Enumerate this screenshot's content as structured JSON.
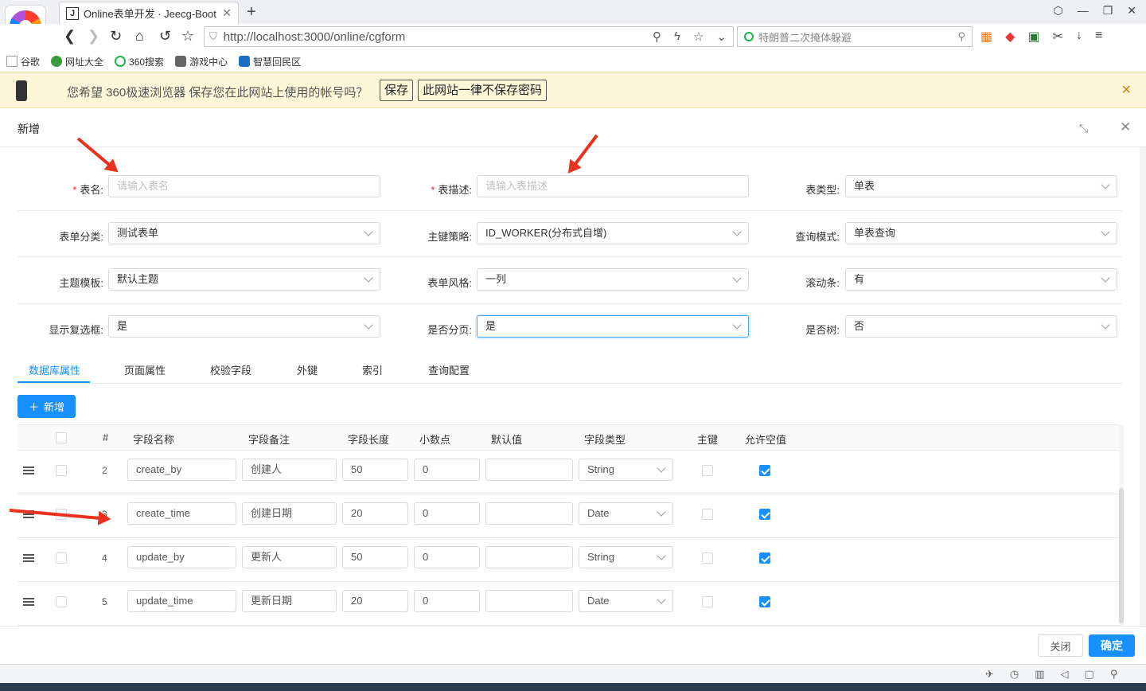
{
  "browser": {
    "tab_title": "Online表单开发 · Jeecg-Boot 企",
    "tab_favicon": "J",
    "url_host": "http://localhost",
    "url_path": ":3000/online/cgform",
    "search_placeholder": "特朗普二次掩体躲避",
    "bookmarks": [
      "谷歌",
      "网址大全",
      "360搜索",
      "游戏中心",
      "智慧回民区"
    ]
  },
  "password_bar": {
    "message": "您希望 360极速浏览器 保存您在此网站上使用的帐号吗？",
    "save_label": "保存",
    "never_label": "此网站一律不保存密码"
  },
  "modal": {
    "title": "新增",
    "form": {
      "table_name": {
        "label": "表名:",
        "placeholder": "请输入表名",
        "required": true
      },
      "table_desc": {
        "label": "表描述:",
        "placeholder": "请输入表描述",
        "required": true
      },
      "table_type": {
        "label": "表类型:",
        "value": "单表"
      },
      "form_category": {
        "label": "表单分类:",
        "value": "测试表单"
      },
      "pk_strategy": {
        "label": "主键策略:",
        "value": "ID_WORKER(分布式自增)"
      },
      "query_mode": {
        "label": "查询模式:",
        "value": "单表查询"
      },
      "theme_template": {
        "label": "主题模板:",
        "value": "默认主题"
      },
      "form_style": {
        "label": "表单风格:",
        "value": "一列"
      },
      "scrollbar": {
        "label": "滚动条:",
        "value": "有"
      },
      "show_checkbox": {
        "label": "显示复选框:",
        "value": "是"
      },
      "paging": {
        "label": "是否分页:",
        "value": "是"
      },
      "is_tree": {
        "label": "是否树:",
        "value": "否"
      }
    },
    "tabs": [
      "数据库属性",
      "页面属性",
      "校验字段",
      "外键",
      "索引",
      "查询配置"
    ],
    "active_tab": 0,
    "add_button": "新增",
    "table": {
      "columns": [
        "#",
        "字段名称",
        "字段备注",
        "字段长度",
        "小数点",
        "默认值",
        "字段类型",
        "主键",
        "允许空值"
      ],
      "rows": [
        {
          "num": "2",
          "name": "create_by",
          "remark": "创建人",
          "length": "50",
          "decimal": "0",
          "default": "",
          "type": "String",
          "pk": false,
          "nullable": true
        },
        {
          "num": "3",
          "name": "create_time",
          "remark": "创建日期",
          "length": "20",
          "decimal": "0",
          "default": "",
          "type": "Date",
          "pk": false,
          "nullable": true
        },
        {
          "num": "4",
          "name": "update_by",
          "remark": "更新人",
          "length": "50",
          "decimal": "0",
          "default": "",
          "type": "String",
          "pk": false,
          "nullable": true
        },
        {
          "num": "5",
          "name": "update_time",
          "remark": "更新日期",
          "length": "20",
          "decimal": "0",
          "default": "",
          "type": "Date",
          "pk": false,
          "nullable": true
        }
      ]
    },
    "footer": {
      "close_label": "关闭",
      "ok_label": "确定"
    }
  },
  "colors": {
    "primary": "#1890ff",
    "annotation_red": "#e8321f",
    "required": "#f5222d"
  }
}
